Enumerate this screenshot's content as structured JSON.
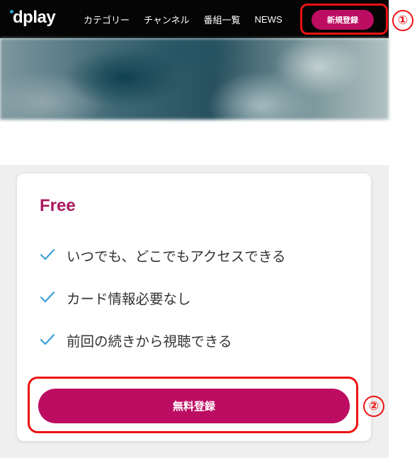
{
  "header": {
    "logo_text": "dplay",
    "nav_items": [
      "カテゴリー",
      "チャンネル",
      "番組一覧",
      "NEWS"
    ],
    "signup_label": "新規登録"
  },
  "annotations": {
    "one": "①",
    "two": "②"
  },
  "plan": {
    "name": "Free",
    "features": [
      "いつでも、どこでもアクセスできる",
      "カード情報必要なし",
      "前回の続きから視聴できる"
    ],
    "cta_label": "無料登録"
  },
  "colors": {
    "brand": "#bd0d63",
    "plan_name": "#a9195f",
    "check": "#3aa0d8",
    "annotation": "#ee1111",
    "nav_bg": "#050505"
  },
  "icons": {
    "feature_check": "check-icon",
    "logo_dot": "logo-dot-icon"
  }
}
